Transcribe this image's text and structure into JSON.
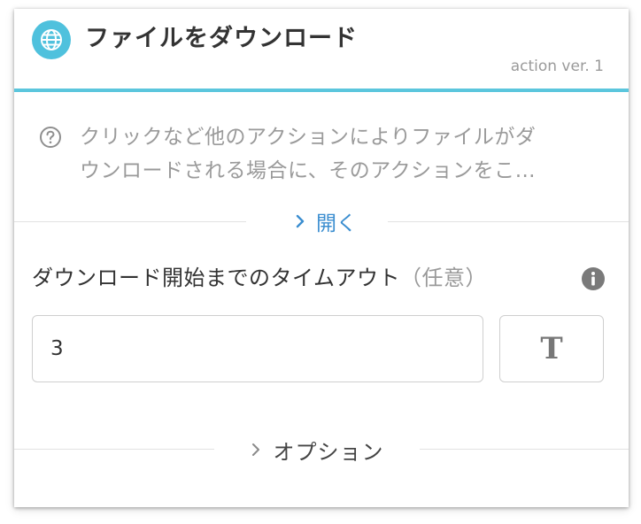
{
  "header": {
    "title": "ファイルをダウンロード",
    "version": "action ver. 1",
    "icon": "globe-icon",
    "accent_color": "#5bc6dd"
  },
  "description": {
    "icon": "question-circle-icon",
    "line1": "クリックなど他のアクションによりファイルがダ",
    "line2": "ウンロードされる場合に、そのアクションをこ…",
    "expand_label": "開く"
  },
  "field": {
    "label": "ダウンロード開始までのタイムアウト",
    "optional": "（任意）",
    "info_icon": "info-icon",
    "value": "3",
    "type_button_label": "T"
  },
  "options": {
    "label": "オプション"
  }
}
